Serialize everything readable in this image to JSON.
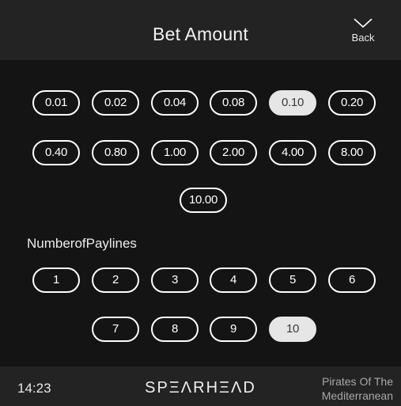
{
  "header": {
    "title": "Bet Amount",
    "back_label": "Back",
    "back_icon": "chevron-down-icon"
  },
  "bet_amounts": {
    "options": [
      "0.01",
      "0.02",
      "0.04",
      "0.08",
      "0.10",
      "0.20",
      "0.40",
      "0.80",
      "1.00",
      "2.00",
      "4.00",
      "8.00",
      "10.00"
    ],
    "selected": "0.10"
  },
  "paylines": {
    "label": "NumberofPaylines",
    "options": [
      "1",
      "2",
      "3",
      "4",
      "5",
      "6",
      "7",
      "8",
      "9",
      "10"
    ],
    "selected": "10"
  },
  "footer": {
    "time": "14:23",
    "logo": "SPΞΛRHΞΛD",
    "game_name": "Pirates Of The Mediterranean"
  },
  "colors": {
    "background": "#141414",
    "bar": "#232323",
    "selected_fill": "#e6e6e6",
    "outline": "#ffffff"
  }
}
